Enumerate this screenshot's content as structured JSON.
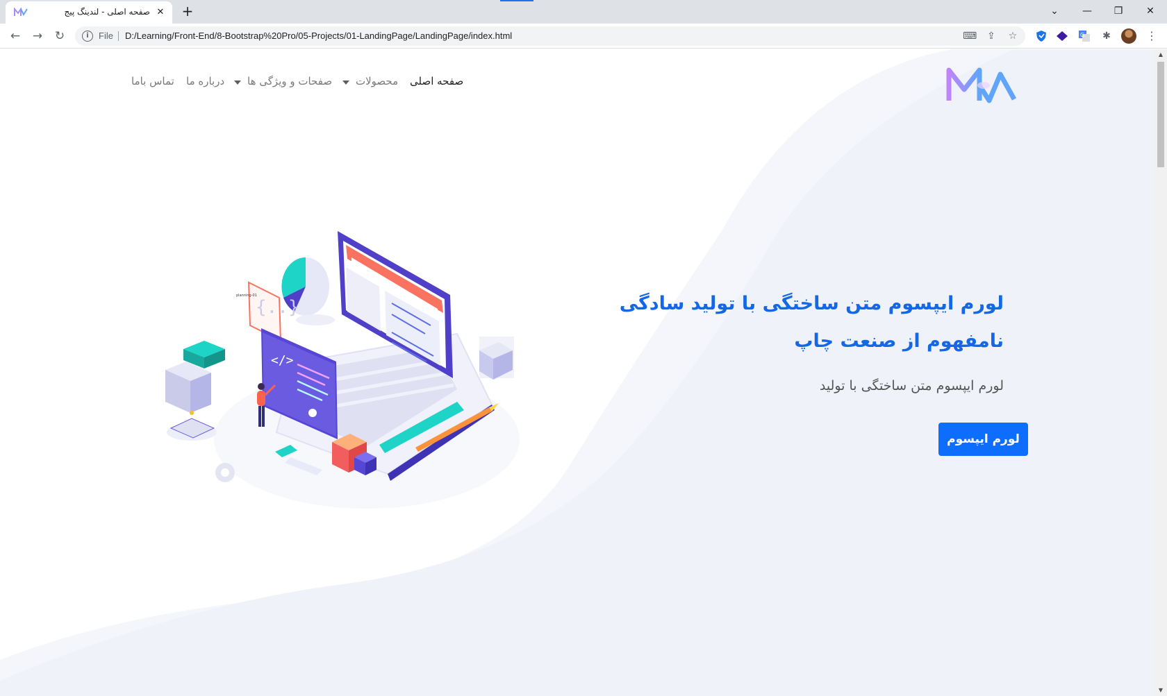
{
  "browser": {
    "tab_title": "صفحه اصلی - لندینگ پیج",
    "tab_close": "✕",
    "new_tab": "+",
    "file_label": "File",
    "url": "D:/Learning/Front-End/8-Bootstrap%20Pro/05-Projects/01-LandingPage/LandingPage/index.html"
  },
  "navbar": {
    "logo": "MW",
    "items": [
      {
        "label": "صفحه اصلی",
        "active": true
      },
      {
        "label": "محصولات",
        "dropdown": false
      },
      {
        "label": "صفحات و ویژگی ها",
        "dropdown": true
      },
      {
        "label": "درباره ما",
        "dropdown": true
      },
      {
        "label": "تماس باما"
      }
    ]
  },
  "hero": {
    "title": "لورم ایپسوم متن ساختگی با تولید سادگی نامفهوم از صنعت چاپ",
    "subtitle": "لورم ایپسوم متن ساختگی با تولید",
    "button_label": "لورم ایپسوم"
  },
  "illustration": {
    "sticker_label": "planning-01"
  },
  "colors": {
    "accent": "#0d6efd",
    "title": "#1467e5",
    "wave": "#f3f5fb"
  }
}
